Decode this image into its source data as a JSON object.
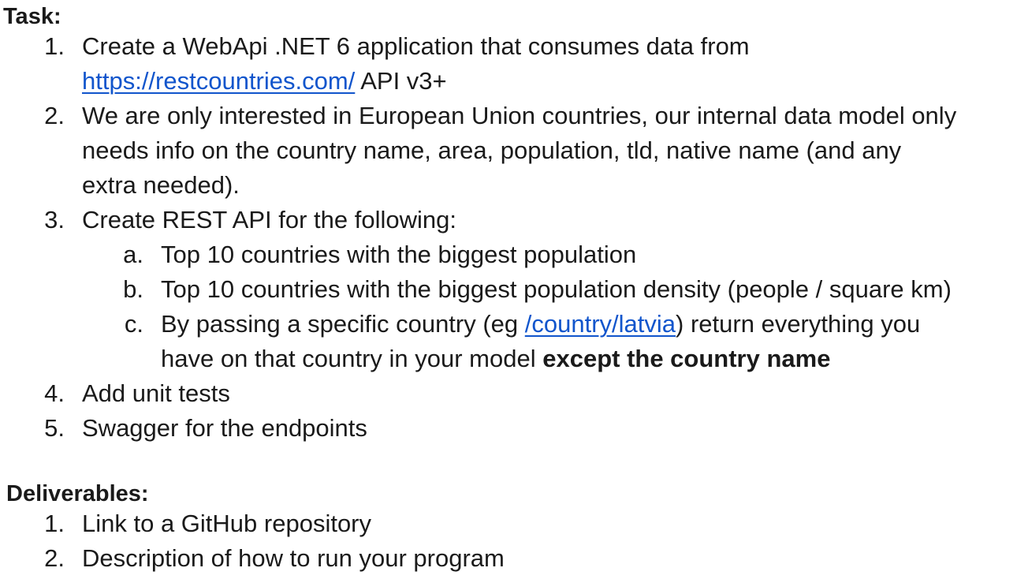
{
  "task": {
    "heading": "Task:",
    "items": [
      {
        "number": "1.",
        "line1": "Create a WebApi .NET 6 application that consumes data from",
        "link": "https://restcountries.com/",
        "line2_rest": " API v3+"
      },
      {
        "number": "2.",
        "line1": "We are only interested in European Union countries, our internal data model only",
        "line2": "needs info on the country name, area, population, tld, native name (and any",
        "line3": "extra needed)."
      },
      {
        "number": "3.",
        "line1": "Create REST API for the following:",
        "subitems": [
          {
            "letter": "a.",
            "text": "Top 10 countries with the biggest population"
          },
          {
            "letter": "b.",
            "text": "Top 10 countries with the biggest population density (people / square km)"
          },
          {
            "letter": "c.",
            "line1_before": "By passing a specific country (eg ",
            "link": "/country/latvia",
            "line1_after": ") return everything you",
            "line2_normal": "have on that country in your model ",
            "line2_bold": "except the country name"
          }
        ]
      },
      {
        "number": "4.",
        "line1": "Add unit tests"
      },
      {
        "number": "5.",
        "line1": "Swagger for the endpoints"
      }
    ]
  },
  "deliverables": {
    "heading": "Deliverables:",
    "items": [
      {
        "number": "1.",
        "text": "Link to a GitHub repository"
      },
      {
        "number": "2.",
        "text": "Description of how to run your program"
      }
    ]
  },
  "colors": {
    "text": "#1a1a1a",
    "link": "#1155cc"
  }
}
